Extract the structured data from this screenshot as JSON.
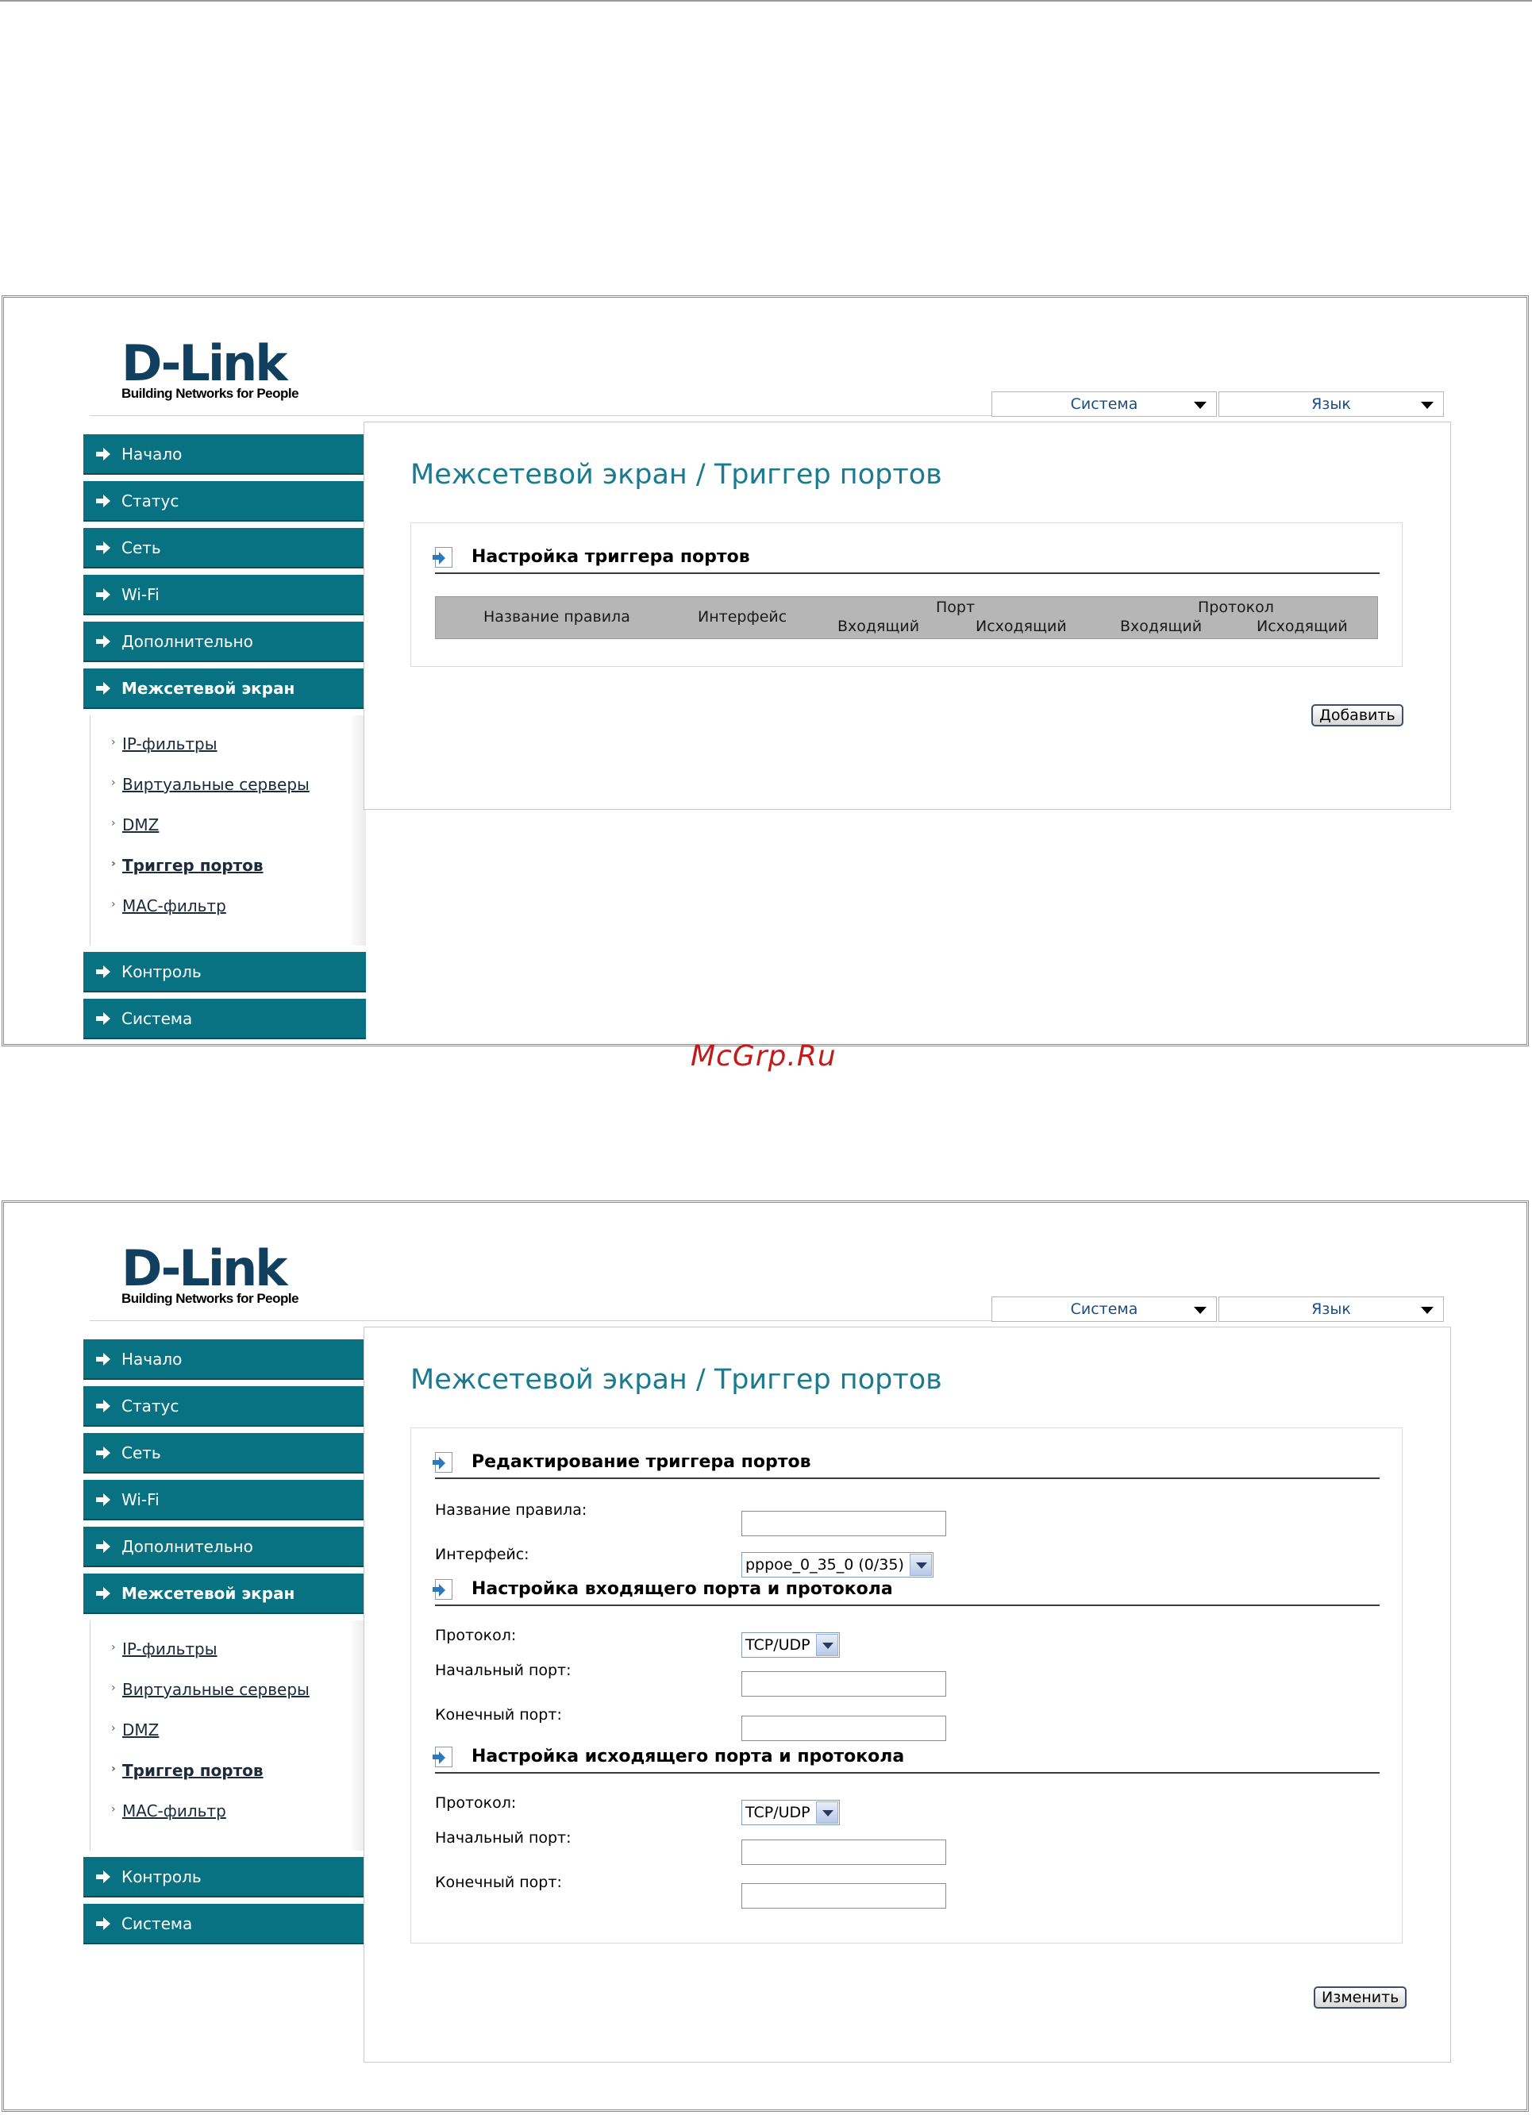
{
  "watermark": "McGrp.Ru",
  "screens": [
    {
      "logo": {
        "wordmark": "D-Link",
        "tagline": "Building Networks for People"
      },
      "top_selects": {
        "system": "Система",
        "language": "Язык"
      },
      "nav": {
        "items": [
          "Начало",
          "Статус",
          "Сеть",
          "Wi-Fi",
          "Дополнительно",
          "Межсетевой экран"
        ],
        "sub_items": [
          "IP-фильтры",
          "Виртуальные серверы",
          "DMZ",
          "Триггер портов",
          "MAC-фильтр"
        ],
        "bottom_items": [
          "Контроль",
          "Система"
        ],
        "active": "Межсетевой экран",
        "current_sub": "Триггер портов"
      },
      "page_title": "Межсетевой экран / Триггер портов",
      "section_title": "Настройка триггера портов",
      "table_headers": {
        "rule_name": "Название правила",
        "interface": "Интерфейс",
        "port": "Порт",
        "protocol": "Протокол",
        "port_in": "Входящий",
        "port_out": "Исходящий",
        "proto_in": "Входящий",
        "proto_out": "Исходящий"
      },
      "add_button": "Добавить"
    },
    {
      "logo": {
        "wordmark": "D-Link",
        "tagline": "Building Networks for People"
      },
      "top_selects": {
        "system": "Система",
        "language": "Язык"
      },
      "nav": {
        "items": [
          "Начало",
          "Статус",
          "Сеть",
          "Wi-Fi",
          "Дополнительно",
          "Межсетевой экран"
        ],
        "sub_items": [
          "IP-фильтры",
          "Виртуальные серверы",
          "DMZ",
          "Триггер портов",
          "MAC-фильтр"
        ],
        "bottom_items": [
          "Контроль",
          "Система"
        ],
        "active": "Межсетевой экран",
        "current_sub": "Триггер портов"
      },
      "page_title": "Межсетевой экран / Триггер портов",
      "edit_section": {
        "title": "Редактирование триггера портов",
        "rule_name_label": "Название правила:",
        "rule_name_value": "",
        "interface_label": "Интерфейс:",
        "interface_value": "pppoe_0_35_0 (0/35)"
      },
      "incoming_section": {
        "title": "Настройка входящего порта и протокола",
        "protocol_label": "Протокол:",
        "protocol_value": "TCP/UDP",
        "start_port_label": "Начальный порт:",
        "start_port_value": "",
        "end_port_label": "Конечный порт:",
        "end_port_value": ""
      },
      "outgoing_section": {
        "title": "Настройка исходящего порта и протокола",
        "protocol_label": "Протокол:",
        "protocol_value": "TCP/UDP",
        "start_port_label": "Начальный порт:",
        "start_port_value": "",
        "end_port_label": "Конечный порт:",
        "end_port_value": ""
      },
      "save_button": "Изменить"
    }
  ]
}
